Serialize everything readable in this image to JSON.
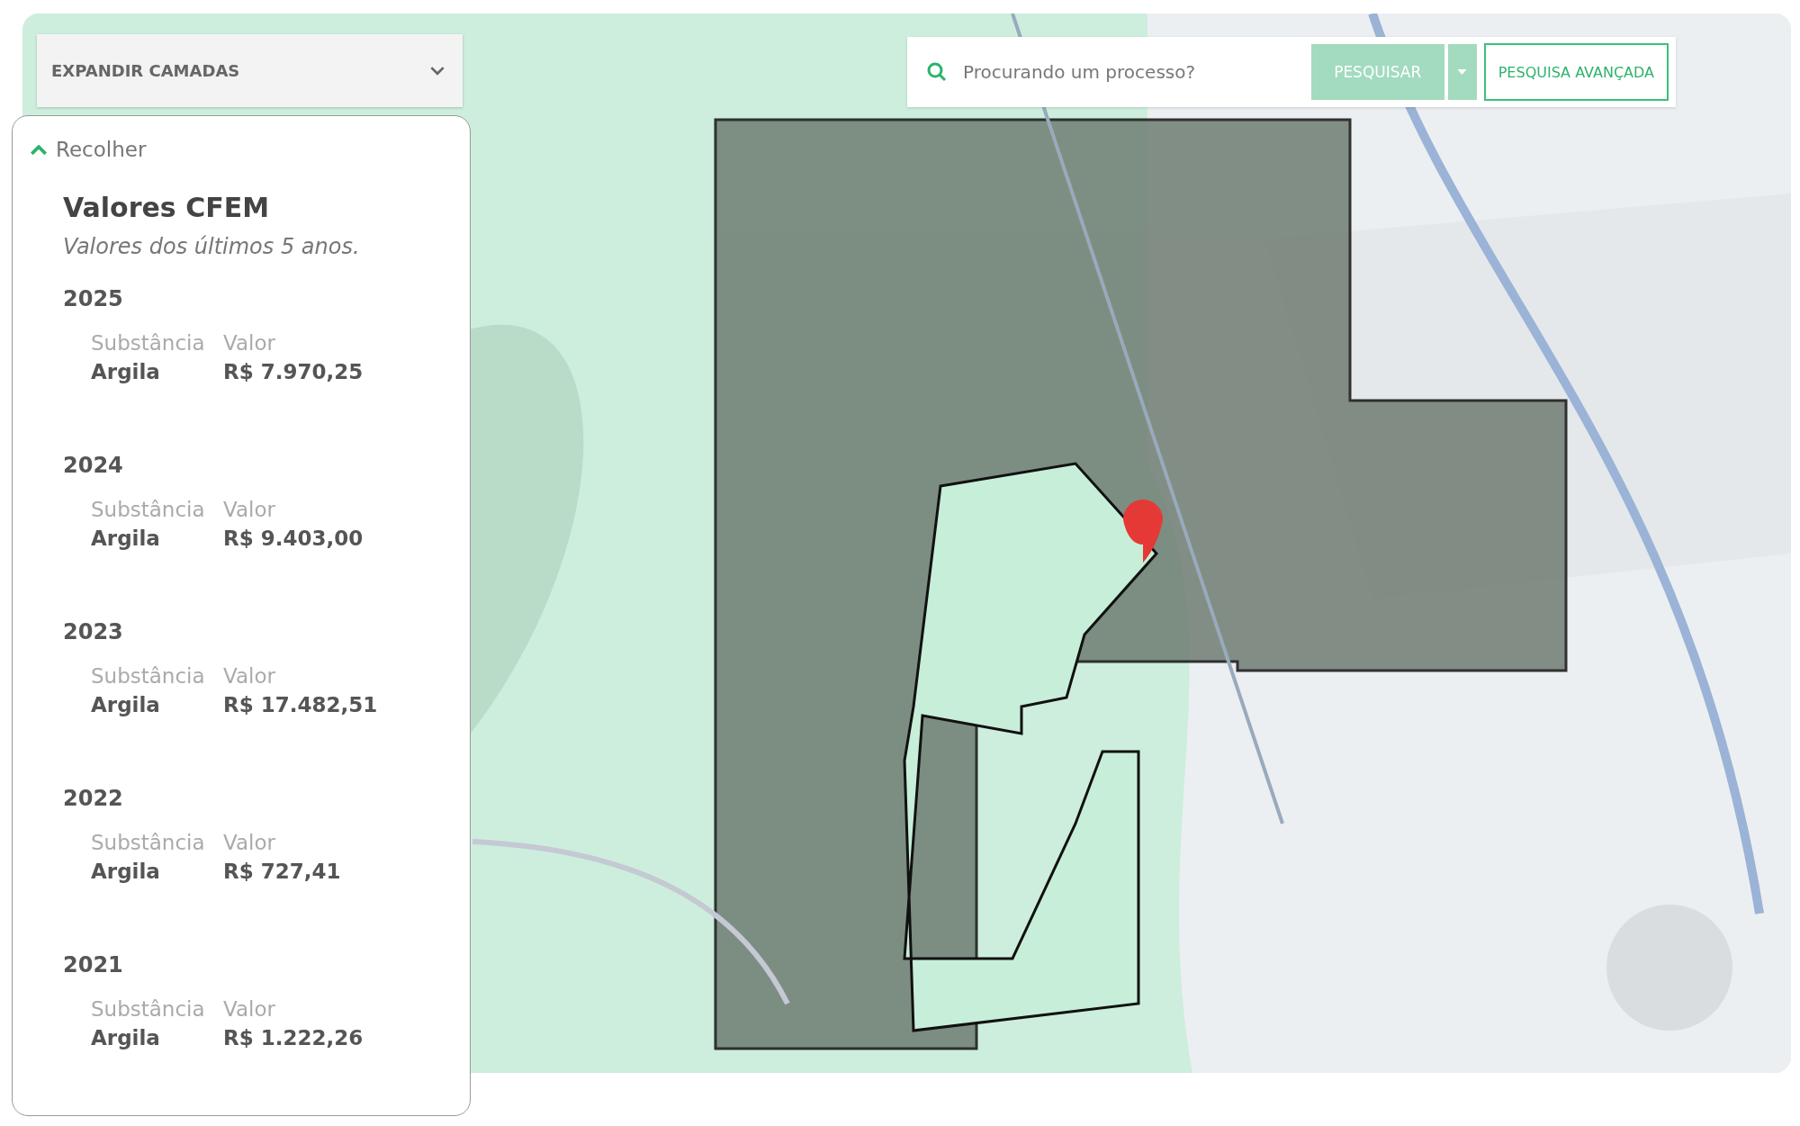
{
  "layers_dropdown": {
    "label": "EXPANDIR CAMADAS",
    "expanded": false
  },
  "search": {
    "placeholder": "Procurando um processo?",
    "search_button": "PESQUISAR",
    "advanced_button": "PESQUISA AVANÇADA"
  },
  "panel": {
    "collapse_label": "Recolher",
    "expanded": true,
    "title": "Valores CFEM",
    "subtitle": "Valores dos últimos 5 anos.",
    "years": [
      {
        "year": "2025",
        "substance_header": "Substância",
        "value_header": "Valor",
        "substance": "Argila",
        "value": "R$ 7.970,25"
      },
      {
        "year": "2024",
        "substance_header": "Substância",
        "value_header": "Valor",
        "substance": "Argila",
        "value": "R$ 9.403,00"
      },
      {
        "year": "2023",
        "substance_header": "Substância",
        "value_header": "Valor",
        "substance": "Argila",
        "value": "R$ 17.482,51"
      },
      {
        "year": "2022",
        "substance_header": "Substância",
        "value_header": "Valor",
        "substance": "Argila",
        "value": "R$ 727,41"
      },
      {
        "year": "2021",
        "substance_header": "Substância",
        "value_header": "Valor",
        "substance": "Argila",
        "value": "R$ 1.222,26"
      }
    ]
  }
}
